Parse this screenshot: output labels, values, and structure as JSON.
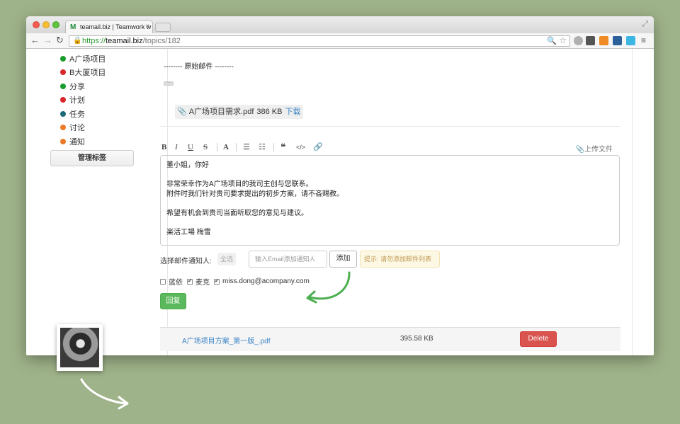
{
  "browser": {
    "tab_title": "teamail.biz | Teamwork w",
    "tab_favicon": "M",
    "tab_close": "×",
    "url_scheme": "https://",
    "url_host": "teamail.biz",
    "url_path": "/topics/182"
  },
  "sidebar": {
    "tags": [
      {
        "label": "A广场项目",
        "color": "#1a9c2c"
      },
      {
        "label": "B大厦项目",
        "color": "#d9262c"
      },
      {
        "label": "分享",
        "color": "#1a9c2c"
      },
      {
        "label": "计划",
        "color": "#d9262c"
      },
      {
        "label": "任务",
        "color": "#1d6a78"
      },
      {
        "label": "讨论",
        "color": "#ec7a2b"
      },
      {
        "label": "通知",
        "color": "#ec7a2b"
      }
    ],
    "manage_button": "管理标签"
  },
  "email": {
    "original_header": "-------- 原始邮件 --------",
    "ellipsis": "···",
    "attachment": {
      "name": "A广场项目需求.pdf",
      "size": "386 KB",
      "download": "下载"
    }
  },
  "editor": {
    "toolbar": [
      "B",
      "I",
      "U",
      "S",
      "A",
      "list-ordered-icon",
      "list-bullet-icon",
      "quote-icon",
      "code-icon",
      "link-icon"
    ],
    "upload_label": "上传文件",
    "lines": [
      "董小姐，你好",
      "",
      "非常荣幸作为A广场项目的我司主创与您联系。",
      "附件时我们针对贵司要求提出的初步方案，请不吝赐教。",
      "",
      "希望有机会到贵司当面听取您的意见与建议。",
      "",
      "楽活工場 梅雪"
    ]
  },
  "notify": {
    "label": "选择邮件通知人:",
    "select_all": "全选",
    "email_placeholder": "输入Email添加通知人",
    "add_button": "添加",
    "hint": "提示: 请勿添加邮件列表",
    "recipients": [
      {
        "label": "蓝依",
        "checked": false
      },
      {
        "label": "麦克",
        "checked": true
      },
      {
        "label": "miss.dong@acompany.com",
        "checked": true
      }
    ]
  },
  "reply_button": "回复",
  "file": {
    "name": "A广场项目方案_第一版_.pdf",
    "size": "395.58 KB",
    "delete": "Delete"
  },
  "colors": {
    "accent_green": "#5cb85c",
    "danger": "#d9534f",
    "link": "#3d85c6",
    "background": "#9fb38a"
  }
}
